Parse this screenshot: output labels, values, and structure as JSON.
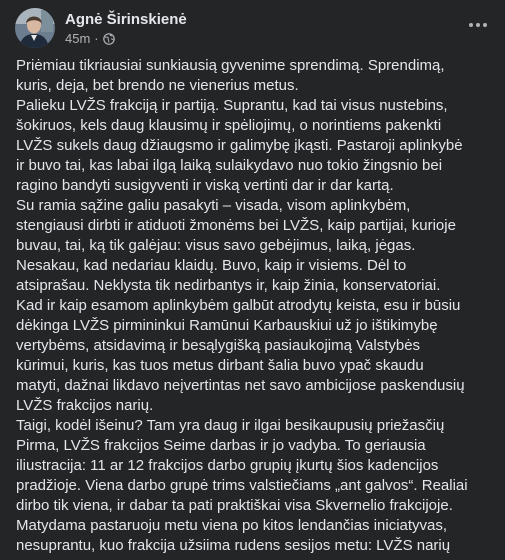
{
  "post": {
    "author": "Agnė Širinskienė",
    "timestamp": "45m",
    "separator": "·",
    "privacy_icon": "globe-icon",
    "menu_icon": "more-horizontal-icon",
    "lines": [
      "Priėmiau tikriausiai sunkiausią gyvenime sprendimą. Sprendimą,",
      "kuris, deja, bet brendo ne vienerius metus.",
      "Palieku LVŽS frakciją ir partiją. Suprantu, kad tai visus nustebins,",
      "šokiruos, kels daug klausimų ir spėliojimų, o norintiems pakenkti",
      "LVŽS sukels daug džiaugsmo ir galimybę įkąsti. Pastaroji aplinkybė",
      "ir buvo tai, kas labai ilgą laiką sulaikydavo nuo tokio žingsnio bei",
      "ragino bandyti susigyventi ir viską vertinti dar ir dar kartą.",
      "Su ramia sąžine galiu pasakyti – visada, visom aplinkybėm,",
      "stengiausi dirbti ir atiduoti žmonėms bei LVŽS, kaip partijai, kurioje",
      "buvau, tai, ką tik galėjau: visus savo gebėjimus, laiką, jėgas.",
      "Nesakau, kad nedariau klaidų. Buvo, kaip ir visiems. Dėl to",
      "atsiprašau. Neklysta tik nedirbantys ir, kaip žinia, konservatoriai.",
      "Kad ir kaip esamom aplinkybėm galbūt atrodytų keista, esu ir būsiu",
      "dėkinga LVŽS pirmininkui Ramūnui Karbauskiui už jo ištikimybę",
      "vertybėms, atsidavimą ir besąlygišką pasiaukojimą Valstybės",
      "kūrimui, kuris, kas tuos metus dirbant šalia buvo ypač skaudu",
      "matyti, dažnai likdavo neįvertintas net savo ambicijose paskendusių",
      "LVŽS frakcijos narių.",
      "Taigi, kodėl išeinu? Tam yra daug ir ilgai besikaupusių priežasčių",
      "Pirma, LVŽS frakcijos Seime darbas ir jo vadyba. To geriausia",
      "iliustracija: 11 ar 12  frakcijos darbo grupių įkurtų šios kadencijos",
      "pradžioje. Viena darbo grupė trims valstiečiams „ant galvos“. Realiai",
      "dirbo tik viena, ir dabar ta pati praktiškai visa Skvernelio frakcijoje.",
      "Matydama pastaruoju metu  viena po kitos lendančias iniciatyvas,",
      "nesuprantu, kuo frakcija užsiima rudens sesijos metu: LVŽS narių"
    ]
  },
  "colors": {
    "background": "#242526",
    "text": "#e4e6eb",
    "secondary_text": "#b0b3b8"
  }
}
